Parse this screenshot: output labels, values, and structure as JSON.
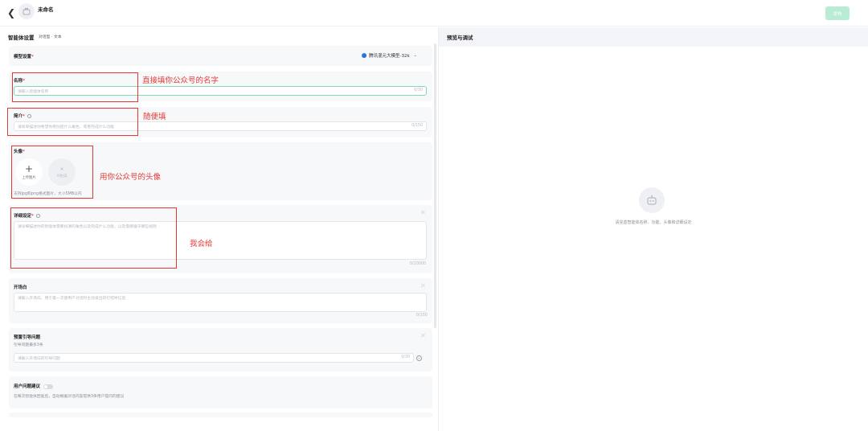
{
  "header": {
    "app_title": "未命名",
    "publish_label": "发布",
    "back_icon": "chevron-left-icon",
    "app_icon": "briefcase-icon"
  },
  "left_panel": {
    "title": "智能体设置",
    "subtitle": "对话型 · 文本",
    "model": {
      "label": "模型设置",
      "value": "腾讯混元大模型-32k"
    },
    "name": {
      "label": "名称",
      "placeholder": "请输入智能体名称",
      "count": "0/30"
    },
    "intro": {
      "label": "简介",
      "placeholder": "请简单描述你希望你用创造什么角色、或者完成什么功能",
      "count": "0/150"
    },
    "avatar": {
      "label": "头像",
      "upload_label": "上传图片",
      "ai_label": "AI生成",
      "hint": "支持jpg和png格式图片，大小5MB以内"
    },
    "detail": {
      "label": "详细设定",
      "placeholder": "请详细描述你的智能体需要扮演的角色以及完成什么功能，以及需要遵守哪些规则",
      "count": "0/10000"
    },
    "opening": {
      "label": "开场白",
      "placeholder": "请输入开场白，用于第一次使用户对话时主动发出的打招呼信息",
      "count": "0/150"
    },
    "preset": {
      "label": "预置引导问题",
      "hint": "引导问题最多3条",
      "placeholder": "请输入开场白的引导问题",
      "count": "0/30"
    },
    "suggest": {
      "label": "用户问题建议",
      "hint": "在每次智能体回复后，自动根据对话内容提供3条用户提问的建议"
    }
  },
  "right_panel": {
    "title": "预览与调试",
    "empty_text": "请完善智能体名称、功能、头像和详细设定",
    "empty_icon": "robot-icon"
  },
  "annotations": {
    "name_note": "直接填你公众号的名字",
    "intro_note": "随便填",
    "avatar_note": "用你公众号的头像",
    "detail_note": "我会给"
  },
  "colors": {
    "annotation_red": "#e53935",
    "publish_disabled": "#b8ecd6",
    "field_active_border": "#7fd9b6"
  }
}
